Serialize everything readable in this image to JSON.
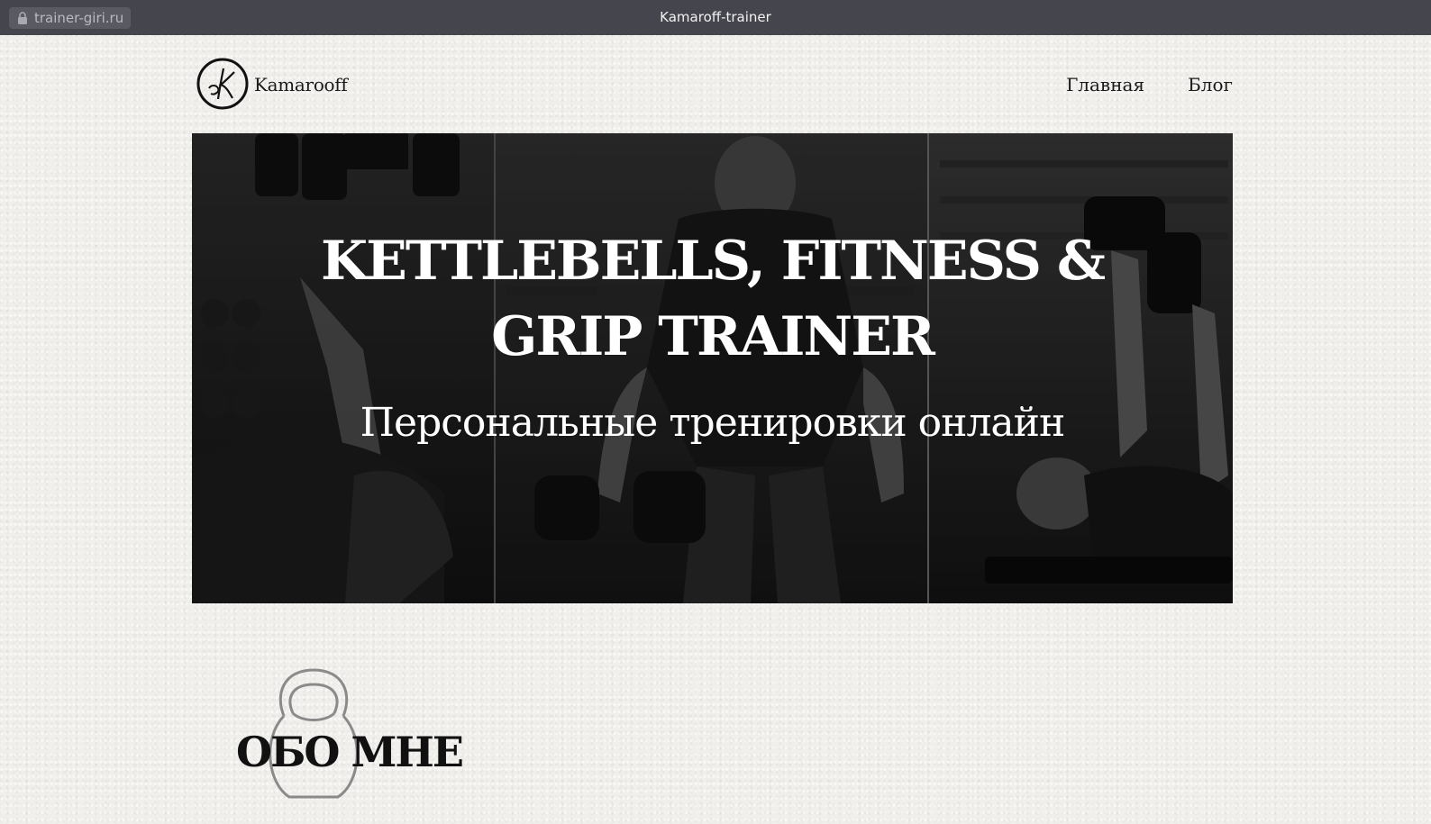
{
  "browser": {
    "url": "trainer-giri.ru",
    "tab_title": "Kamaroff-trainer"
  },
  "header": {
    "brand": "Kamarooff",
    "nav": [
      "Главная",
      "Блог"
    ]
  },
  "hero": {
    "title": "KETTLEBELLS, FITNESS & GRIP TRAINER",
    "subtitle": "Персональные тренировки онлайн"
  },
  "about": {
    "title": "ОБО МНЕ"
  },
  "colors": {
    "page_bg": "#f1efec",
    "browser_bar": "#45454d",
    "hero_bg": "#1b1b1b",
    "text": "#1a1a1a"
  },
  "icons": [
    "lock-icon",
    "logo-icon",
    "kettlebell-icon"
  ]
}
